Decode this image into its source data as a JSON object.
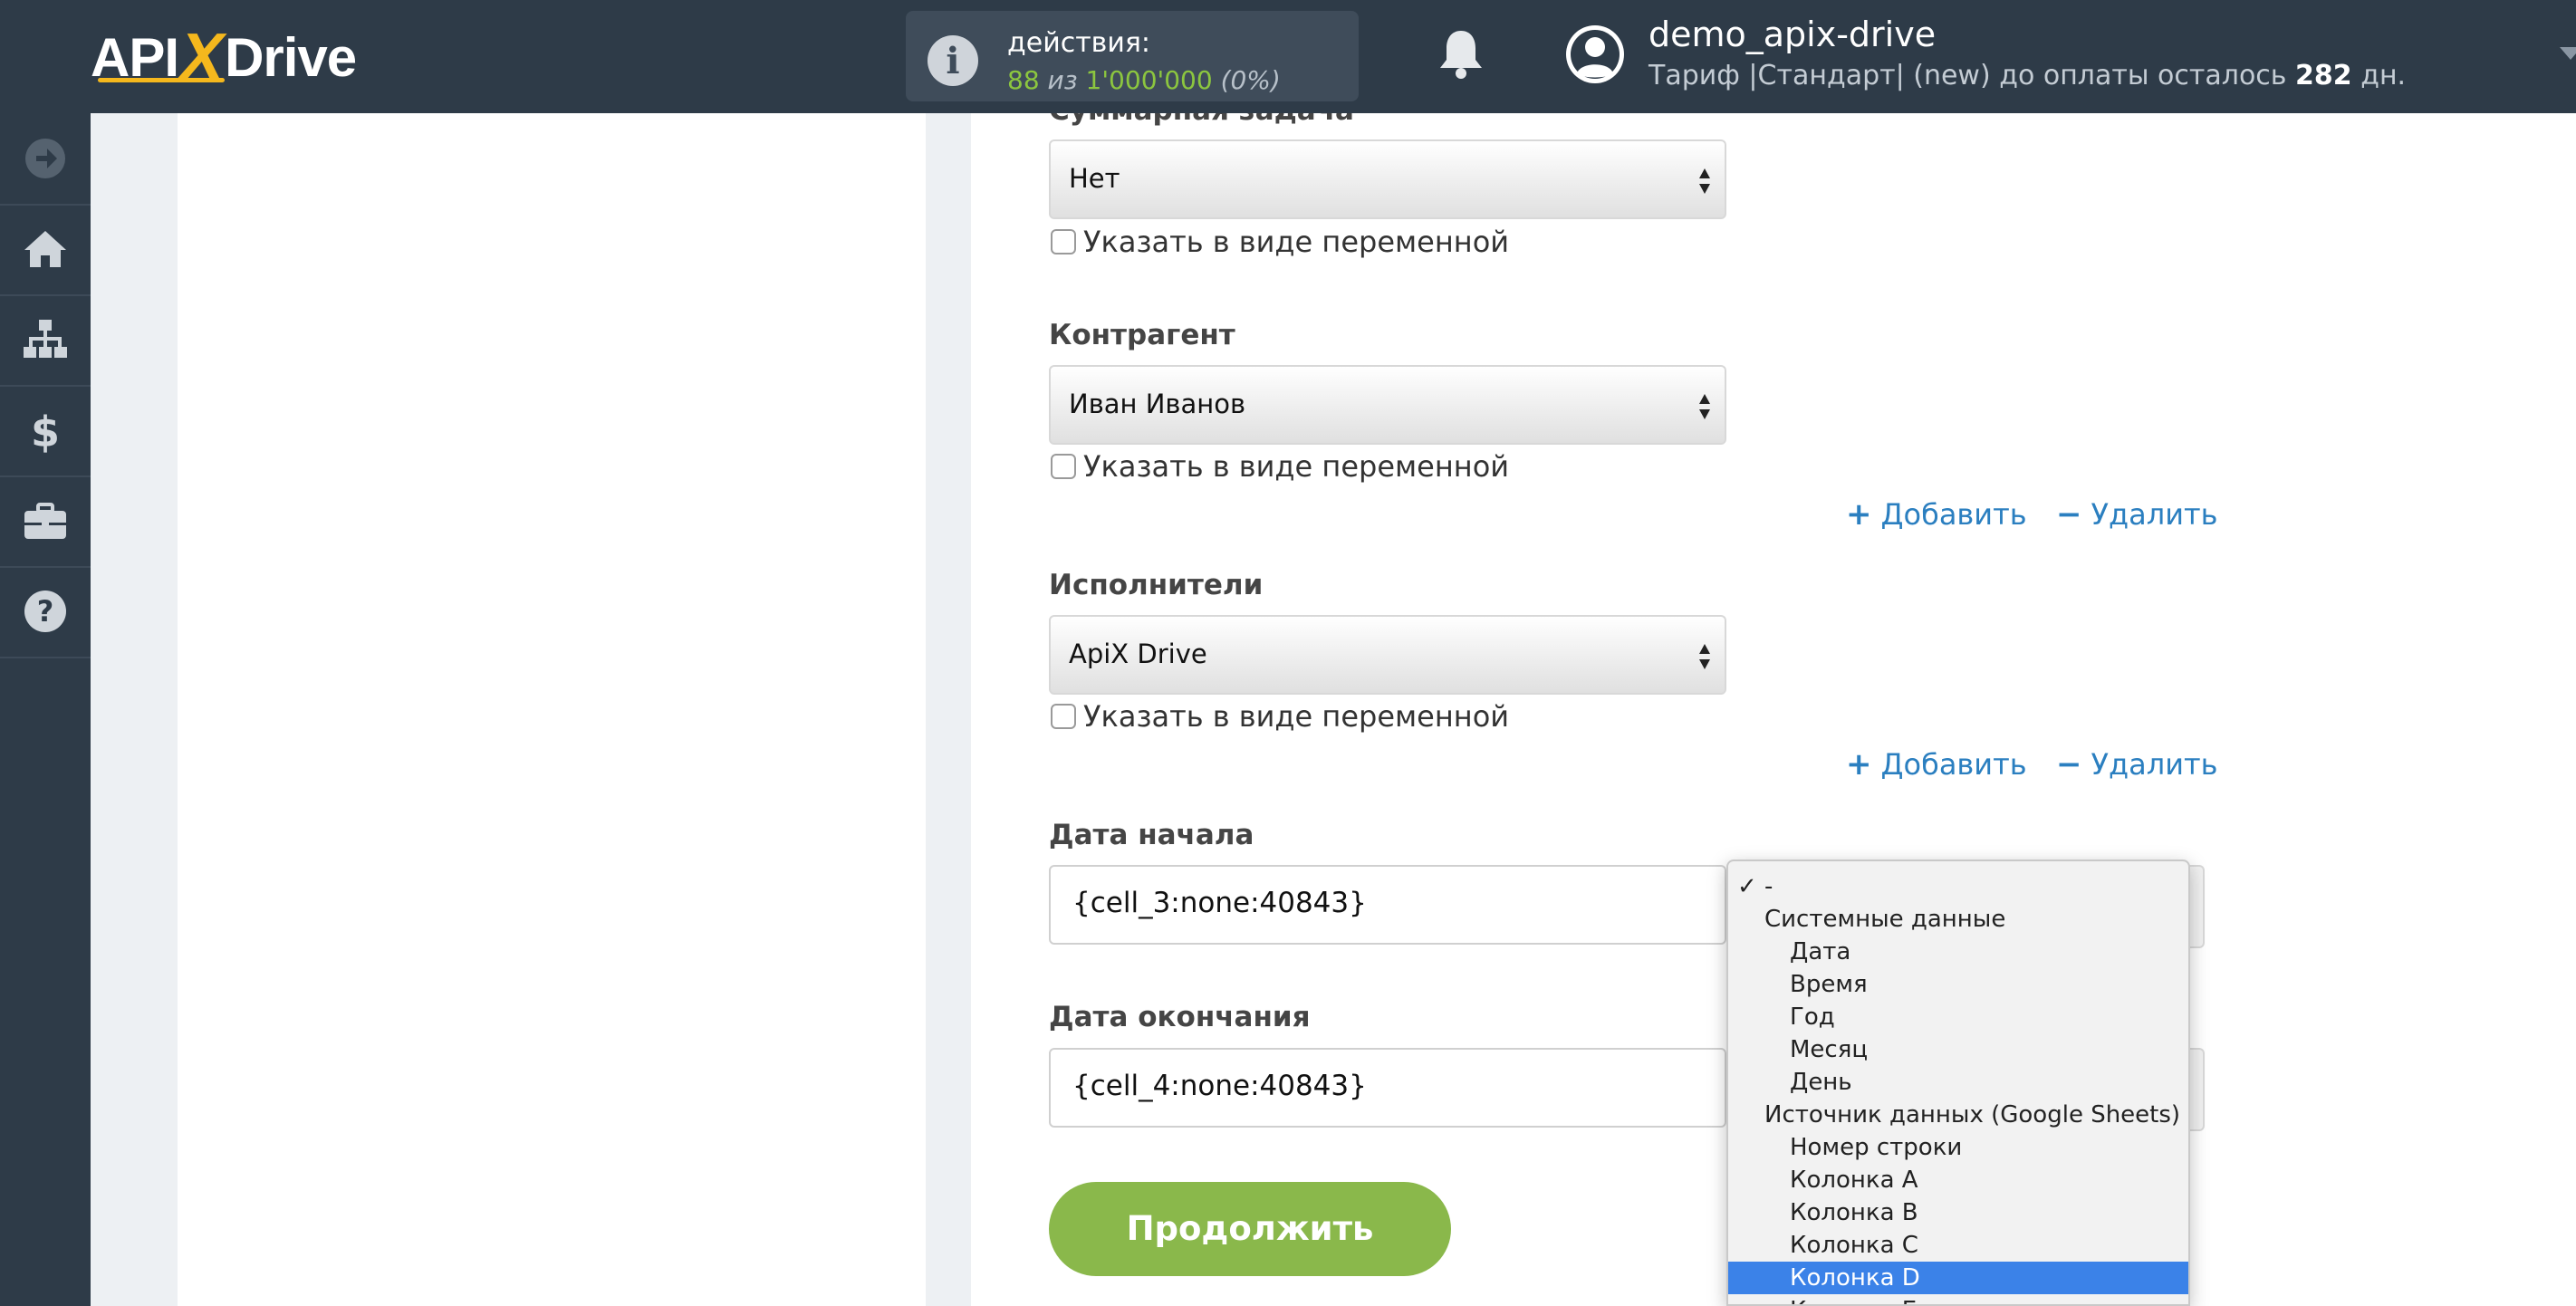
{
  "header": {
    "logo_left": "API",
    "logo_x": "X",
    "logo_right": "Drive",
    "actions_label": "действия:",
    "actions_used": "88",
    "actions_of": "из",
    "actions_limit": "1'000'000",
    "actions_pct": "(0%)",
    "username": "demo_apix-drive",
    "tariff_text": "Тариф |Стандарт| (new) до оплаты осталось",
    "days_left": "282",
    "days_unit": "дн."
  },
  "sidebar": {
    "items": [
      "arrow-right-icon",
      "home-icon",
      "sitemap-icon",
      "dollar-icon",
      "briefcase-icon",
      "help-icon"
    ]
  },
  "form": {
    "summary_task": {
      "label": "Суммарная задача",
      "value": "Нет",
      "checkbox_label": "Указать в виде переменной"
    },
    "counterparty": {
      "label": "Контрагент",
      "value": "Иван Иванов",
      "checkbox_label": "Указать в виде переменной",
      "add_label": "Добавить",
      "remove_label": "Удалить"
    },
    "executors": {
      "label": "Исполнители",
      "value": "ApiX Drive",
      "checkbox_label": "Указать в виде переменной",
      "add_label": "Добавить",
      "remove_label": "Удалить"
    },
    "start_date": {
      "label": "Дата начала",
      "value": "{cell_3:none:40843}"
    },
    "end_date": {
      "label": "Дата окончания",
      "value": "{cell_4:none:40843}"
    },
    "continue_label": "Продолжить"
  },
  "dropdown": {
    "checkmark": "✓",
    "items": [
      {
        "text": "-",
        "level": 0,
        "checked": true
      },
      {
        "text": "Системные данные",
        "level": 1
      },
      {
        "text": "Дата",
        "level": 2
      },
      {
        "text": "Время",
        "level": 2
      },
      {
        "text": "Год",
        "level": 2
      },
      {
        "text": "Месяц",
        "level": 2
      },
      {
        "text": "День",
        "level": 2
      },
      {
        "text": "Источник данных (Google Sheets)",
        "level": 1
      },
      {
        "text": "Номер строки",
        "level": 2
      },
      {
        "text": "Колонка A",
        "level": 2
      },
      {
        "text": "Колонка B",
        "level": 2
      },
      {
        "text": "Колонка C",
        "level": 2
      },
      {
        "text": "Колонка D",
        "level": 2,
        "selected": true
      },
      {
        "text": "Колонка E",
        "level": 2
      }
    ]
  },
  "colors": {
    "header_bg": "#2e3b48",
    "accent_green": "#8ab84b",
    "link_blue": "#2b7fc0",
    "selection_blue": "#3b82e8"
  }
}
